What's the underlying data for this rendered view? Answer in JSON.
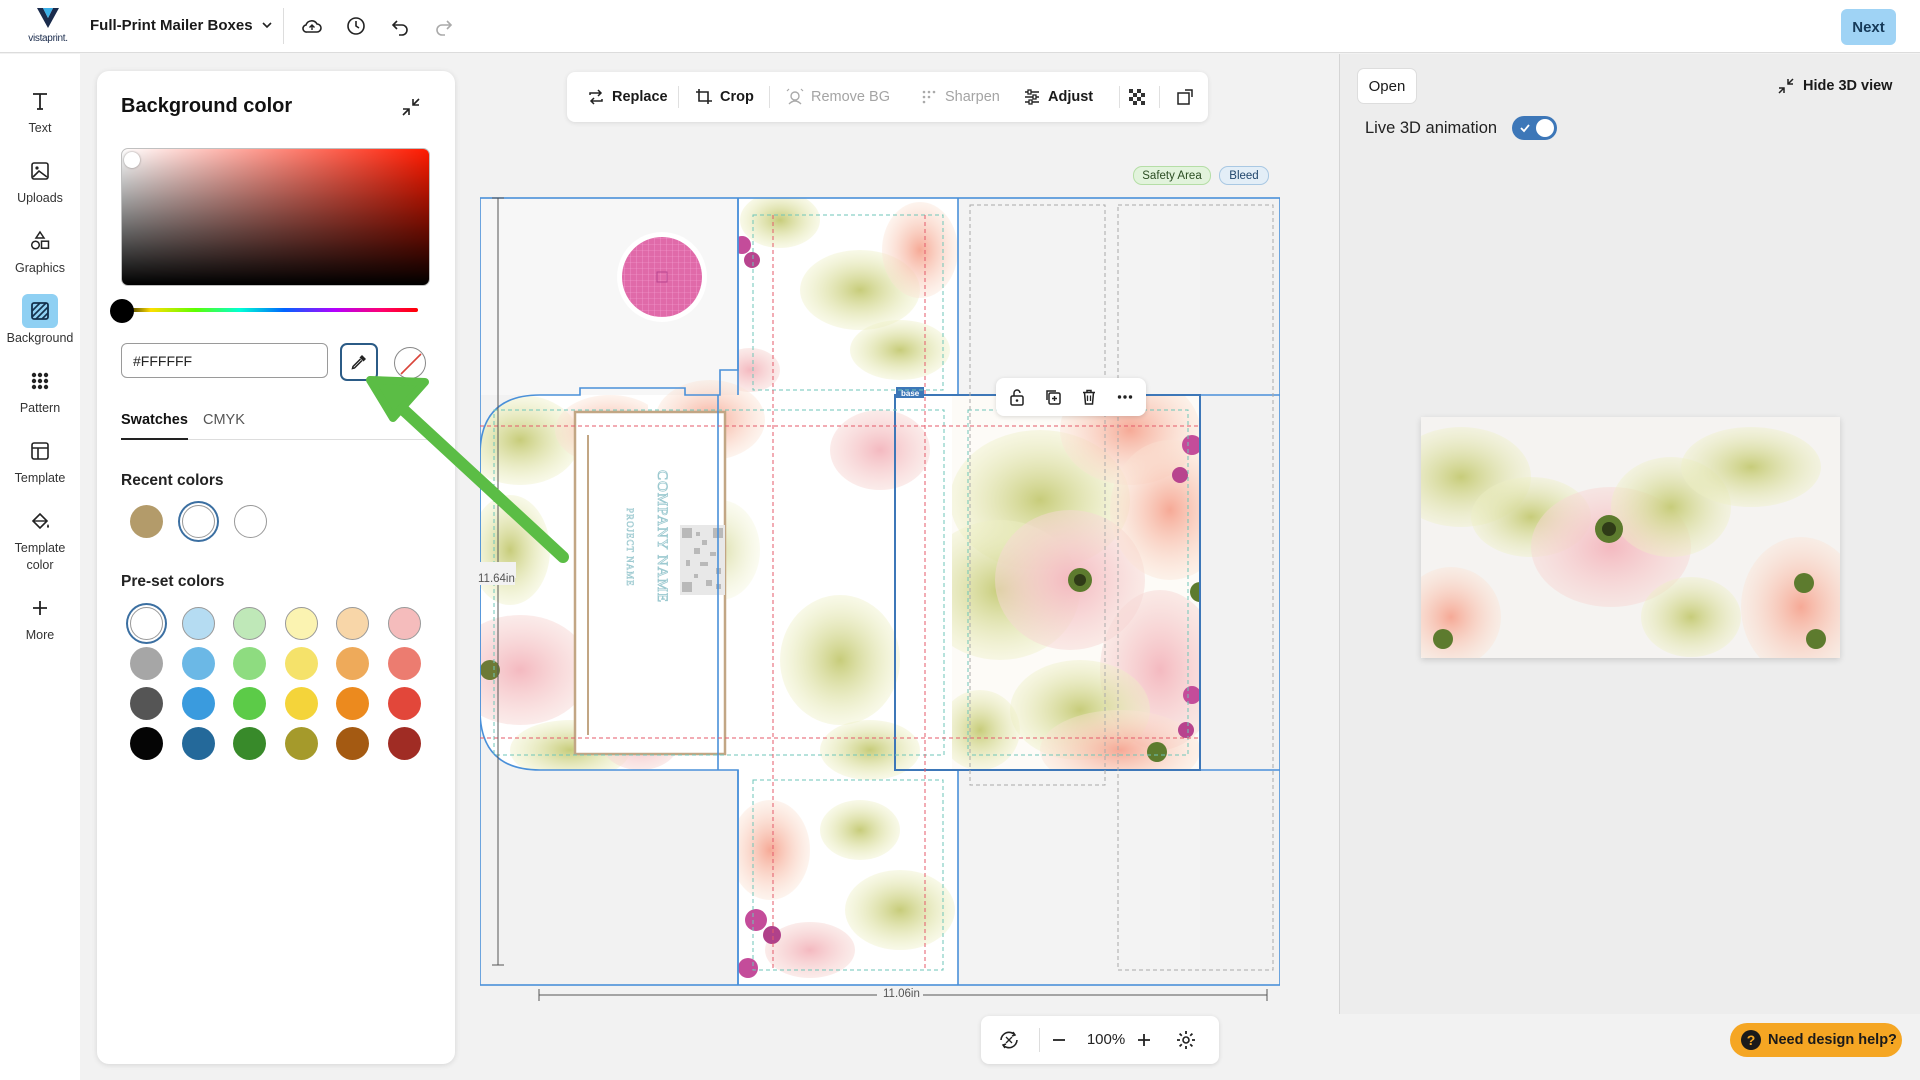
{
  "header": {
    "logo_text": "vistaprint.",
    "product_title": "Full-Print Mailer Boxes",
    "next_label": "Next"
  },
  "leftrail": {
    "items": [
      {
        "label": "Text",
        "icon": "text-icon"
      },
      {
        "label": "Uploads",
        "icon": "image-upload-icon"
      },
      {
        "label": "Graphics",
        "icon": "shapes-icon"
      },
      {
        "label": "Background",
        "icon": "background-icon",
        "active": true
      },
      {
        "label": "Pattern",
        "icon": "pattern-icon"
      },
      {
        "label": "Template",
        "icon": "template-icon"
      },
      {
        "label": "Template color",
        "icon": "paint-bucket-icon"
      },
      {
        "label": "More",
        "icon": "plus-icon"
      }
    ]
  },
  "color_panel": {
    "title": "Background color",
    "hex_value": "#FFFFFF",
    "tabs": [
      "Swatches",
      "CMYK"
    ],
    "recent_title": "Recent colors",
    "recent_colors": [
      "#b39b6a",
      "#ffffff",
      "#ffffff"
    ],
    "preset_title": "Pre-set colors",
    "preset_colors": [
      [
        "#ffffff",
        "#b5dcf2",
        "#bfe8b8",
        "#fbf3b1",
        "#f8d6a8",
        "#f5bcbc"
      ],
      [
        "#a6a6a6",
        "#6bb8e6",
        "#8edc80",
        "#f5e26a",
        "#eeaa5a",
        "#ec7c70"
      ],
      [
        "#555555",
        "#3a9bde",
        "#5ccb48",
        "#f4d43a",
        "#ec8a1e",
        "#e2473a"
      ],
      [
        "#050505",
        "#24699a",
        "#388a2a",
        "#a59a2b",
        "#a45a12",
        "#a02c24"
      ]
    ],
    "selected_color": "#ffffff"
  },
  "image_toolbar": {
    "replace": "Replace",
    "crop": "Crop",
    "remove_bg": "Remove BG",
    "sharpen": "Sharpen",
    "adjust": "Adjust"
  },
  "canvas": {
    "safety_area": "Safety Area",
    "bleed": "Bleed",
    "height_label": "11.64in",
    "width_label": "11.06in",
    "selection_tag": "base",
    "company_name": "COMPANY NAME",
    "project_name": "PROJECT NAME",
    "zoom": "100%"
  },
  "right_panel": {
    "open_label": "Open",
    "hide3d_label": "Hide 3D view",
    "live_animation_label": "Live 3D animation",
    "live_animation_on": true,
    "help_label": "Need design help?",
    "help_glyph": "?"
  },
  "colors": {
    "accent": "#3d77b8",
    "next_bg": "#9fd3f5",
    "help_bg": "#f5a623",
    "annotation_arrow": "#5bbd45"
  }
}
